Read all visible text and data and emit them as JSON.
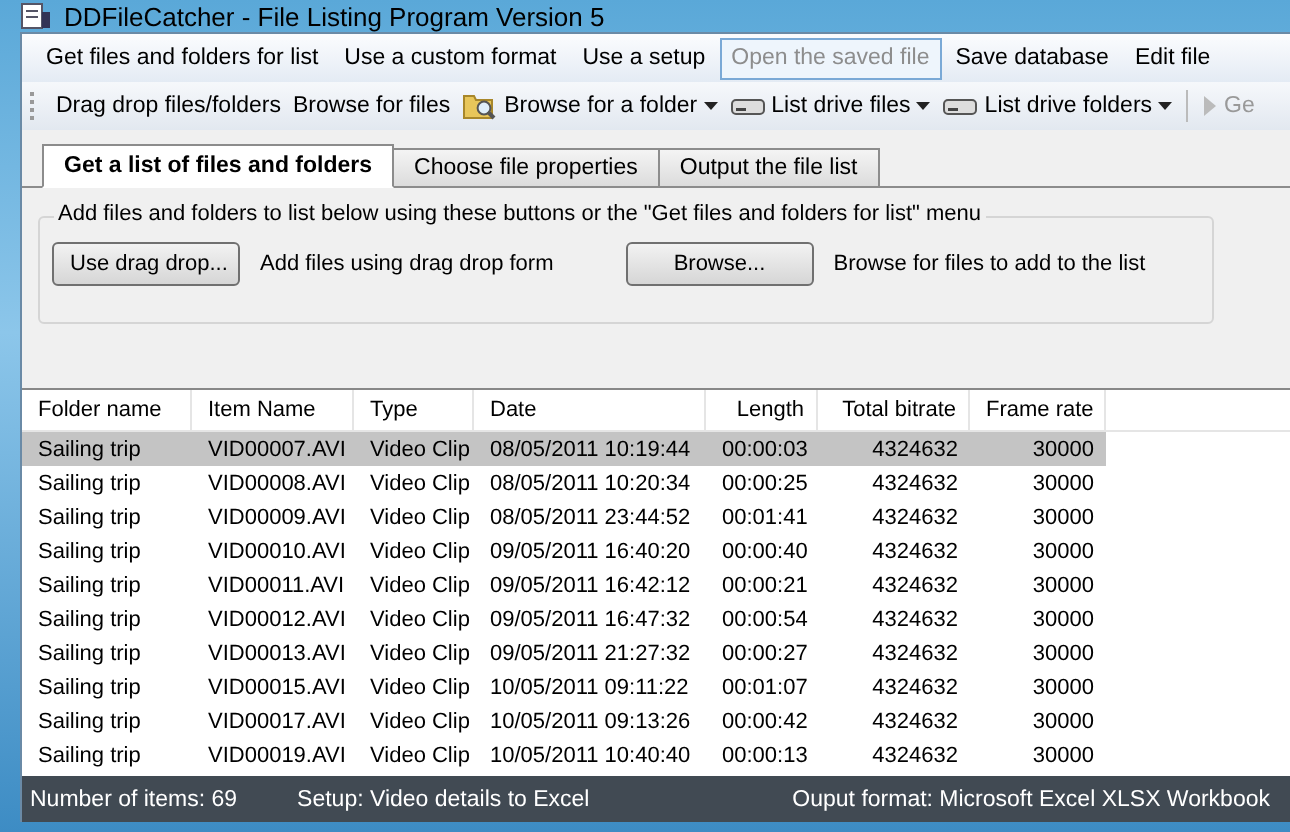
{
  "window": {
    "title": "DDFileCatcher - File Listing Program Version 5"
  },
  "menu": [
    {
      "label": "Get files and folders for list",
      "disabled": false,
      "hovered": false
    },
    {
      "label": "Use a custom format",
      "disabled": false,
      "hovered": false
    },
    {
      "label": "Use a setup",
      "disabled": false,
      "hovered": false
    },
    {
      "label": "Open the saved file",
      "disabled": true,
      "hovered": true
    },
    {
      "label": "Save database",
      "disabled": false,
      "hovered": false
    },
    {
      "label": "Edit file",
      "disabled": false,
      "hovered": false
    }
  ],
  "toolbar": [
    {
      "kind": "text",
      "label": "Drag drop files/folders"
    },
    {
      "kind": "text",
      "label": "Browse for files"
    },
    {
      "kind": "folder_menu",
      "label": "Browse for a folder"
    },
    {
      "kind": "drive_menu",
      "label": "List drive files"
    },
    {
      "kind": "drive_menu",
      "label": "List drive folders"
    },
    {
      "kind": "run",
      "label": "Ge"
    }
  ],
  "tabs": [
    {
      "label": "Get a list of files and folders",
      "selected": true
    },
    {
      "label": "Choose file properties",
      "selected": false
    },
    {
      "label": "Output the file list",
      "selected": false
    }
  ],
  "group": {
    "caption": "Add files and folders to list below using these buttons or the \"Get files and folders for list\" menu",
    "items": [
      {
        "button": "Use drag drop...",
        "description": "Add files using drag drop form"
      },
      {
        "button": "Browse...",
        "description": "Browse for files to add to the list"
      }
    ]
  },
  "table": {
    "columns": [
      "Folder name",
      "Item Name",
      "Type",
      "Date",
      "Length",
      "Total bitrate",
      "Frame rate"
    ],
    "rows": [
      {
        "selected": true,
        "cells": [
          "Sailing trip",
          "VID00007.AVI",
          "Video Clip",
          "08/05/2011 10:19:44",
          "00:00:03",
          "4324632",
          "30000"
        ]
      },
      {
        "selected": false,
        "cells": [
          "Sailing trip",
          "VID00008.AVI",
          "Video Clip",
          "08/05/2011 10:20:34",
          "00:00:25",
          "4324632",
          "30000"
        ]
      },
      {
        "selected": false,
        "cells": [
          "Sailing trip",
          "VID00009.AVI",
          "Video Clip",
          "08/05/2011 23:44:52",
          "00:01:41",
          "4324632",
          "30000"
        ]
      },
      {
        "selected": false,
        "cells": [
          "Sailing trip",
          "VID00010.AVI",
          "Video Clip",
          "09/05/2011 16:40:20",
          "00:00:40",
          "4324632",
          "30000"
        ]
      },
      {
        "selected": false,
        "cells": [
          "Sailing trip",
          "VID00011.AVI",
          "Video Clip",
          "09/05/2011 16:42:12",
          "00:00:21",
          "4324632",
          "30000"
        ]
      },
      {
        "selected": false,
        "cells": [
          "Sailing trip",
          "VID00012.AVI",
          "Video Clip",
          "09/05/2011 16:47:32",
          "00:00:54",
          "4324632",
          "30000"
        ]
      },
      {
        "selected": false,
        "cells": [
          "Sailing trip",
          "VID00013.AVI",
          "Video Clip",
          "09/05/2011 21:27:32",
          "00:00:27",
          "4324632",
          "30000"
        ]
      },
      {
        "selected": false,
        "cells": [
          "Sailing trip",
          "VID00015.AVI",
          "Video Clip",
          "10/05/2011 09:11:22",
          "00:01:07",
          "4324632",
          "30000"
        ]
      },
      {
        "selected": false,
        "cells": [
          "Sailing trip",
          "VID00017.AVI",
          "Video Clip",
          "10/05/2011 09:13:26",
          "00:00:42",
          "4324632",
          "30000"
        ]
      },
      {
        "selected": false,
        "cells": [
          "Sailing trip",
          "VID00019.AVI",
          "Video Clip",
          "10/05/2011 10:40:40",
          "00:00:13",
          "4324632",
          "30000"
        ]
      }
    ]
  },
  "status_bar": {
    "left": [
      "Number of items: 69",
      "Setup: Video details to Excel"
    ],
    "right": "Ouput format: Microsoft Excel XLSX Workbook"
  }
}
